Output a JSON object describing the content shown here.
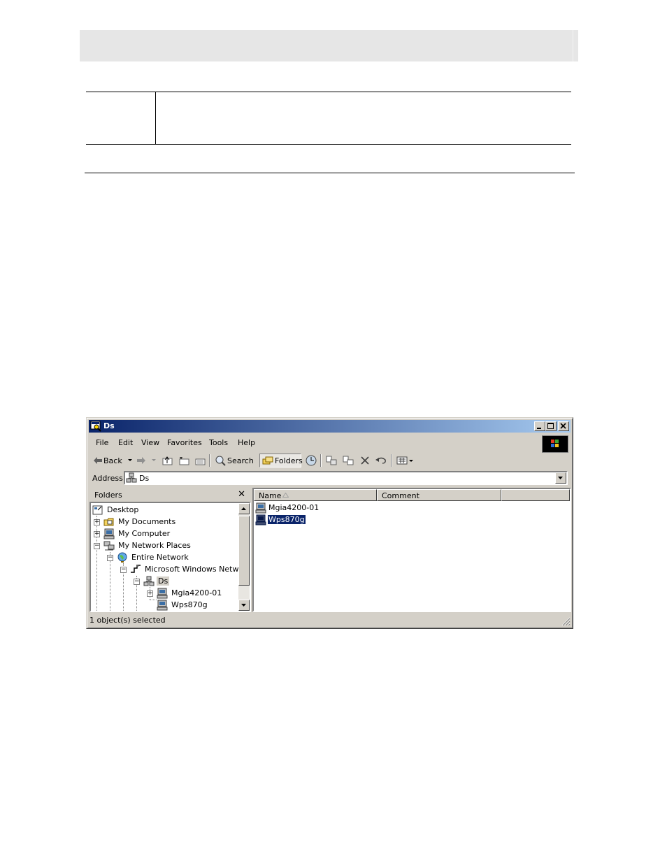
{
  "window": {
    "title": "Ds",
    "menu": [
      "File",
      "Edit",
      "View",
      "Favorites",
      "Tools",
      "Help"
    ],
    "toolbar": {
      "back": "Back",
      "search": "Search",
      "folders": "Folders"
    },
    "address": {
      "label": "Address",
      "value": "Ds"
    },
    "folders_pane": {
      "title": "Folders",
      "tree": [
        {
          "label": "Desktop",
          "icon": "desktop-icon"
        },
        {
          "label": "My Documents",
          "icon": "folder-icon"
        },
        {
          "label": "My Computer",
          "icon": "computer-icon"
        },
        {
          "label": "My Network Places",
          "icon": "network-places-icon"
        },
        {
          "label": "Entire Network",
          "icon": "globe-icon"
        },
        {
          "label": "Microsoft Windows Network",
          "icon": "network-icon"
        },
        {
          "label": "Ds",
          "icon": "workgroup-icon"
        },
        {
          "label": "Mgia4200-01",
          "icon": "computer-icon"
        },
        {
          "label": "Wps870g",
          "icon": "computer-icon"
        }
      ]
    },
    "list": {
      "columns": [
        "Name",
        "Comment"
      ],
      "items": [
        {
          "name": "Mgia4200-01",
          "comment": "",
          "selected": false
        },
        {
          "name": "Wps870g",
          "comment": "",
          "selected": true
        }
      ]
    },
    "status": "1 object(s) selected",
    "colors": {
      "titlebar_start": "#0a246a",
      "titlebar_end": "#a6caf0",
      "selection": "#0a246a",
      "face": "#d4d0c8"
    }
  }
}
